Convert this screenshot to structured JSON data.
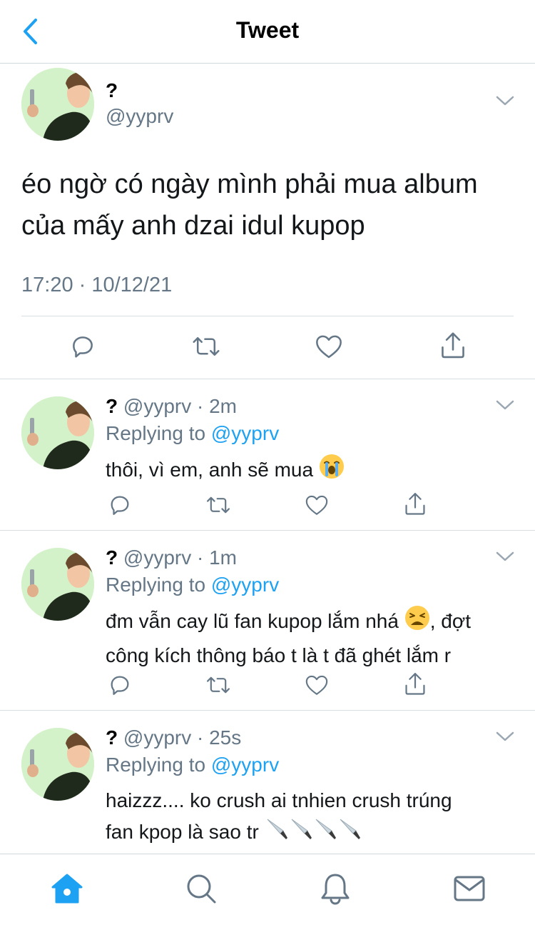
{
  "header": {
    "title": "Tweet"
  },
  "main_tweet": {
    "name": "?",
    "handle": "@yyprv",
    "text_line1": "éo ngờ có ngày mình phải mua album",
    "text_line2": "của mấy anh dzai idul kupop",
    "timestamp": "17:20 · 10/12/21"
  },
  "replies": [
    {
      "name": "?",
      "handle_time": "@yyprv · 2m",
      "replying_prefix": "Replying to ",
      "replying_to": "@yyprv",
      "text_line1": "thôi, vì em, anh sẽ mua",
      "emoji": "loudly-crying-face"
    },
    {
      "name": "?",
      "handle_time": "@yyprv · 1m",
      "replying_prefix": "Replying to ",
      "replying_to": "@yyprv",
      "text_line1_a": "đm vẫn cay lũ fan kupop lắm nhá",
      "text_line1_b": ", đợt",
      "text_line2": "công kích thông báo t là t đã ghét lắm r",
      "emoji": "weary-face"
    },
    {
      "name": "?",
      "handle_time": "@yyprv · 25s",
      "replying_prefix": "Replying to ",
      "replying_to": "@yyprv",
      "text_line1": "haizzz.... ko crush ai tnhien crush trúng",
      "text_line2": "fan kpop là sao tr",
      "emoji": "kitchen-knife"
    }
  ],
  "tabbar": {
    "items": [
      "home-icon",
      "search-icon",
      "notifications-icon",
      "messages-icon"
    ],
    "active": "home-icon"
  },
  "colors": {
    "accent": "#1da1f2",
    "secondary_text": "#657786",
    "icon_gray": "#657786",
    "divider": "#d9dee2"
  }
}
